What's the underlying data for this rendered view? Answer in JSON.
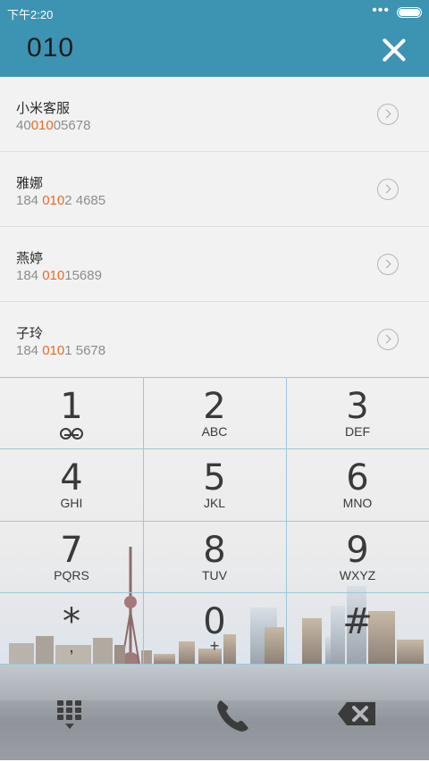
{
  "status_bar": {
    "time": "下午2:20",
    "signal_dots": "•••"
  },
  "header": {
    "dial_input": "010"
  },
  "results": [
    {
      "name": "小米客服",
      "number_pre": "40",
      "number_match": "010",
      "number_post": "05678"
    },
    {
      "name": "雅娜",
      "number_pre": "184 ",
      "number_match": "010",
      "number_post": "2 4685"
    },
    {
      "name": "燕婷",
      "number_pre": "184 ",
      "number_match": "010",
      "number_post": "15689"
    },
    {
      "name": "子玲",
      "number_pre": "184 ",
      "number_match": "010",
      "number_post": "1 5678"
    }
  ],
  "keypad": {
    "keys": [
      {
        "digit": "1",
        "letters": ""
      },
      {
        "digit": "2",
        "letters": "ABC"
      },
      {
        "digit": "3",
        "letters": "DEF"
      },
      {
        "digit": "4",
        "letters": "GHI"
      },
      {
        "digit": "5",
        "letters": "JKL"
      },
      {
        "digit": "6",
        "letters": "MNO"
      },
      {
        "digit": "7",
        "letters": "PQRS"
      },
      {
        "digit": "8",
        "letters": "TUV"
      },
      {
        "digit": "9",
        "letters": "WXYZ"
      },
      {
        "digit": "*",
        "letters": ","
      },
      {
        "digit": "0",
        "letters": "+"
      },
      {
        "digit": "#",
        "letters": ""
      }
    ]
  },
  "colors": {
    "accent": "#3d93b2",
    "match_highlight": "#e56b24",
    "grid_line": "#9dc7d8"
  },
  "icons": {
    "close": "close-icon",
    "detail": "chevron-right-circle-icon",
    "voicemail": "voicemail-icon",
    "dialpad": "dialpad-icon",
    "call": "phone-icon",
    "delete": "backspace-icon"
  }
}
